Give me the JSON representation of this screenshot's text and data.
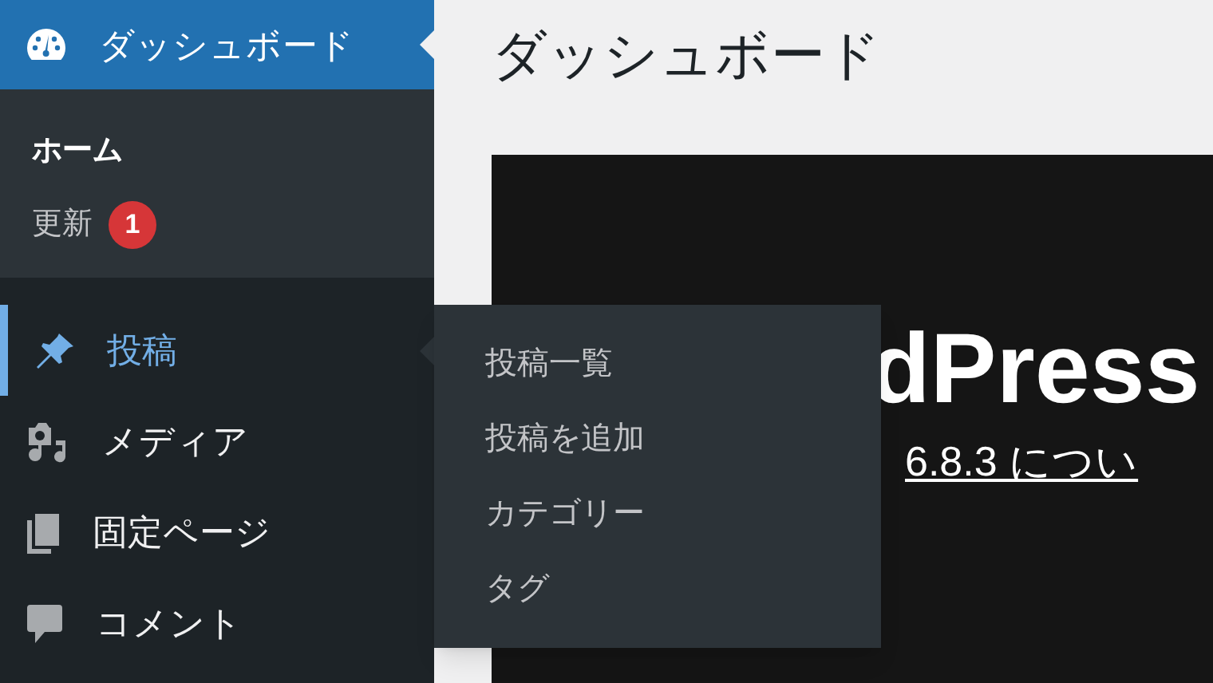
{
  "sidebar": {
    "items": [
      {
        "label": "ダッシュボード",
        "selected": true,
        "hovered": false,
        "submenu": [
          {
            "label": "ホーム",
            "selected": true
          },
          {
            "label": "更新",
            "selected": false,
            "badge": "1"
          }
        ]
      },
      {
        "label": "投稿",
        "selected": false,
        "hovered": true,
        "flyout": [
          {
            "label": "投稿一覧"
          },
          {
            "label": "投稿を追加"
          },
          {
            "label": "カテゴリー"
          },
          {
            "label": "タグ"
          }
        ]
      },
      {
        "label": "メディア",
        "selected": false,
        "hovered": false
      },
      {
        "label": "固定ページ",
        "selected": false,
        "hovered": false
      },
      {
        "label": "コメント",
        "selected": false,
        "hovered": false
      }
    ]
  },
  "main": {
    "title": "ダッシュボード",
    "welcome_panel": {
      "heading": "dPress",
      "link": "6.8.3 につい"
    }
  }
}
